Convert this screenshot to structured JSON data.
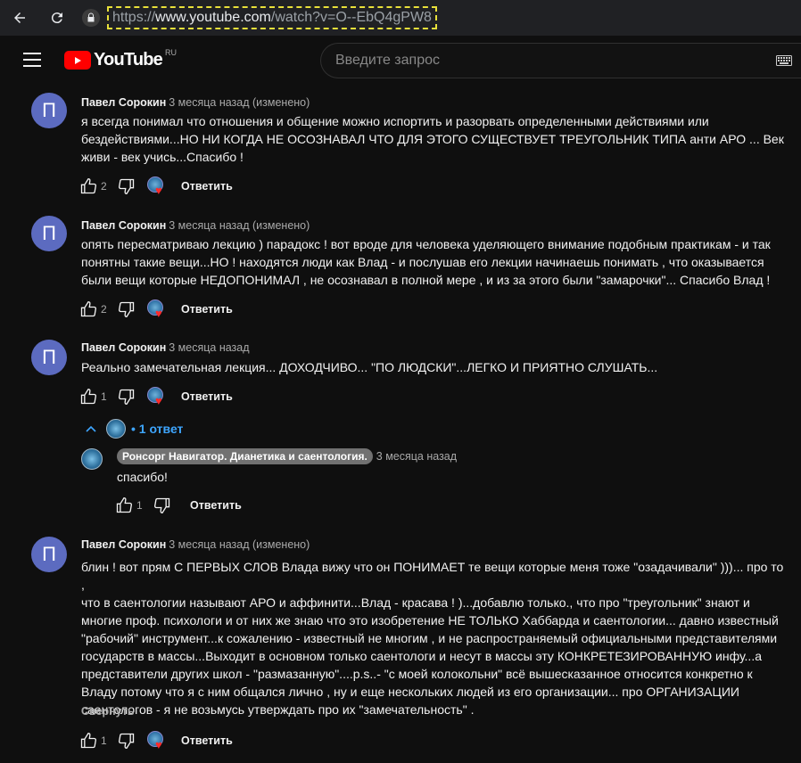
{
  "browser": {
    "url_scheme": "https://",
    "url_host": "www.youtube.com",
    "url_path": "/watch?v=O--EbQ4gPW8"
  },
  "header": {
    "logo_text": "YouTube",
    "logo_region": "RU",
    "search_placeholder": "Введите запрос"
  },
  "comments": [
    {
      "avatar_letter": "П",
      "author": "Павел Сорокин",
      "meta": "3 месяца назад (изменено)",
      "lines": [
        "я всегда понимал что отношения и общение можно испортить и разорвать определенными действиями или",
        "бездействиями...НО НИ КОГДА НЕ ОСОЗНАВАЛ ЧТО ДЛЯ ЭТОГО СУЩЕСТВУЕТ ТРЕУГОЛЬНИК ТИПА анти АРО ... Век",
        "живи - век учись...Спасибо !"
      ],
      "likes": "2",
      "reply_label": "Ответить"
    },
    {
      "avatar_letter": "П",
      "author": "Павел Сорокин",
      "meta": "3 месяца назад (изменено)",
      "lines": [
        "опять пересматриваю лекцию )  парадокс ! вот вроде для человека уделяющего внимание подобным практикам - и так",
        "понятны такие вещи...НО ! находятся люди как Влад - и послушав его лекции начинаешь понимать , что оказывается",
        "были вещи которые НЕДОПОНИМАЛ , не осознавал в полной мере , и из за этого были \"замарочки\"... Спасибо Влад !"
      ],
      "likes": "2",
      "reply_label": "Ответить"
    },
    {
      "avatar_letter": "П",
      "author": "Павел Сорокин",
      "meta": "3 месяца назад",
      "lines": [
        "Реально замечательная лекция... ДОХОДЧИВО... \"ПО ЛЮДСКИ\"...ЛЕГКО И ПРИЯТНО СЛУШАТЬ..."
      ],
      "likes": "1",
      "reply_label": "Ответить",
      "replies_toggle": "• 1 ответ",
      "reply": {
        "author": "Ронсорг Навигатор. Дианетика и саентология.",
        "meta": "3 месяца назад",
        "text": "спасибо!",
        "likes": "1",
        "reply_label": "Ответить"
      }
    },
    {
      "avatar_letter": "П",
      "author": "Павел Сорокин",
      "meta": "3 месяца назад (изменено)",
      "lines": [
        "блин ! вот прям С ПЕРВЫХ СЛОВ Влада вижу что он ПОНИМАЕТ те вещи которые меня тоже \"озадачивали\" )))... про то ,",
        "что в саентологии называют АРО и аффинити...Влад - красава ! )...добавлю только., что про \"треугольник\" знают и",
        "многие проф. психологи и от них же знаю что это изобретение НЕ ТОЛЬКО Хаббарда и саентологии... давно известный",
        "\"рабочий\" инструмент...к сожалению - известный не многим , и не распространяемый официальными представителями",
        "государств в массы...Выходит в основном только саентологи и несут в массы эту КОНКРЕТЕЗИРОВАННУЮ инфу...а",
        "представители других школ - \"размазанную\"....p.s..- \"с моей колокольни\" всё вышесказанное относится конкретно к",
        "Владу потому что я с ним общался лично , ну и еще нескольких людей из его организации... про ОРГАНИЗАЦИИ",
        "саентологов - я не возьмусь утверждать про их \"замечательность\" ."
      ],
      "collapse_label": "Свернуть",
      "likes": "1",
      "reply_label": "Ответить"
    }
  ]
}
